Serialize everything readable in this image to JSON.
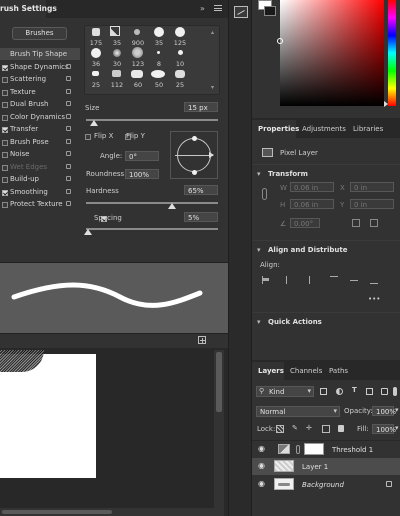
{
  "brush_panel": {
    "tab_title": "rush Settings",
    "brushes_button": "Brushes",
    "options": [
      {
        "label": "Brush Tip Shape",
        "checked": null,
        "lock": false,
        "active": true
      },
      {
        "label": "Shape Dynamics",
        "checked": true,
        "lock": true
      },
      {
        "label": "Scattering",
        "checked": false,
        "lock": true
      },
      {
        "label": "Texture",
        "checked": false,
        "lock": true
      },
      {
        "label": "Dual Brush",
        "checked": false,
        "lock": true
      },
      {
        "label": "Color Dynamics",
        "checked": false,
        "lock": true
      },
      {
        "label": "Transfer",
        "checked": true,
        "lock": true
      },
      {
        "label": "Brush Pose",
        "checked": false,
        "lock": true
      },
      {
        "label": "Noise",
        "checked": false,
        "lock": true
      },
      {
        "label": "Wet Edges",
        "checked": false,
        "lock": true,
        "dim": true
      },
      {
        "label": "Build-up",
        "checked": false,
        "lock": true
      },
      {
        "label": "Smoothing",
        "checked": true,
        "lock": true
      },
      {
        "label": "Protect Texture",
        "checked": false,
        "lock": true
      }
    ],
    "tip_sizes_row1": [
      "175",
      "35",
      "900",
      "35",
      "125"
    ],
    "tip_sizes_row2": [
      "36",
      "30",
      "123",
      "8",
      "10"
    ],
    "tip_sizes_row3": [
      "25",
      "112",
      "60",
      "50",
      "25"
    ],
    "size_label": "Size",
    "size_value": "15 px",
    "flip_x": "Flip X",
    "flip_y": "Flip Y",
    "angle_label": "Angle:",
    "angle_value": "0°",
    "roundness_label": "Roundness:",
    "roundness_value": "100%",
    "hardness_label": "Hardness",
    "hardness_value": "65%",
    "spacing_label": "Spacing",
    "spacing_value": "5%"
  },
  "properties_panel": {
    "tabs": [
      "Properties",
      "Adjustments",
      "Libraries"
    ],
    "layer_type": "Pixel Layer",
    "transform_title": "Transform",
    "w_label": "W",
    "w_value": "0.06 in",
    "x_label": "X",
    "x_value": "0 in",
    "h_label": "H",
    "h_value": "0.06 in",
    "y_label": "Y",
    "y_value": "0 in",
    "angle_value": "0.00°",
    "align_title": "Align and Distribute",
    "align_label": "Align:",
    "more": "•••",
    "quick_actions_title": "Quick Actions"
  },
  "layers_panel": {
    "tabs": [
      "Layers",
      "Channels",
      "Paths"
    ],
    "filter_kind": "Kind",
    "blend_mode": "Normal",
    "opacity_label": "Opacity:",
    "opacity_value": "100%",
    "lock_label": "Lock:",
    "fill_label": "Fill:",
    "fill_value": "100%",
    "layers": [
      {
        "name": "Threshold 1",
        "italic": false,
        "selected": false
      },
      {
        "name": "Layer 1",
        "italic": false,
        "selected": true
      },
      {
        "name": "Background",
        "italic": true,
        "selected": false
      }
    ]
  },
  "colors": {
    "panel_bg": "#323232",
    "dark_bg": "#282828",
    "accent_blue": "#2d7fd8",
    "selected_row": "#4c4c4c"
  }
}
